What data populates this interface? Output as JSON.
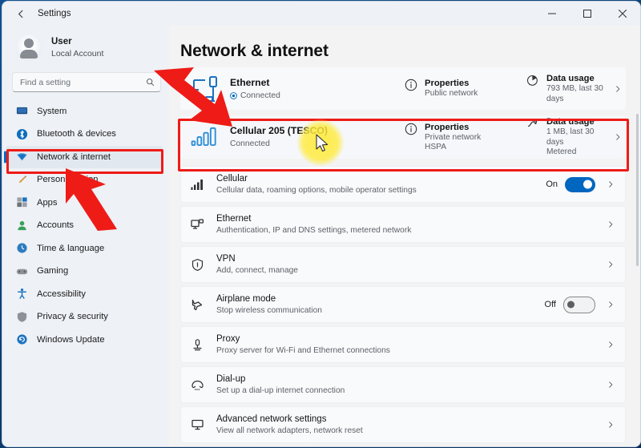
{
  "window": {
    "title": "Settings",
    "back_icon": "back-arrow-icon",
    "minimize_label": "Minimize",
    "maximize_label": "Maximize",
    "close_label": "Close"
  },
  "sidebar": {
    "account": {
      "name": "User",
      "subtitle": "Local Account",
      "avatar_icon": "avatar-icon"
    },
    "search": {
      "placeholder": "Find a setting",
      "value": "",
      "icon": "search-icon"
    },
    "items": [
      {
        "label": "System",
        "icon": "system-icon",
        "selected": false
      },
      {
        "label": "Bluetooth & devices",
        "icon": "bluetooth-icon",
        "selected": false
      },
      {
        "label": "Network & internet",
        "icon": "network-icon",
        "selected": true
      },
      {
        "label": "Personalization",
        "icon": "personalization-icon",
        "selected": false
      },
      {
        "label": "Apps",
        "icon": "apps-icon",
        "selected": false
      },
      {
        "label": "Accounts",
        "icon": "accounts-icon",
        "selected": false
      },
      {
        "label": "Time & language",
        "icon": "time-language-icon",
        "selected": false
      },
      {
        "label": "Gaming",
        "icon": "gaming-icon",
        "selected": false
      },
      {
        "label": "Accessibility",
        "icon": "accessibility-icon",
        "selected": false
      },
      {
        "label": "Privacy & security",
        "icon": "privacy-security-icon",
        "selected": false
      },
      {
        "label": "Windows Update",
        "icon": "windows-update-icon",
        "selected": false
      }
    ]
  },
  "main": {
    "page_title": "Network & internet",
    "status_cards": [
      {
        "id": "ethernet",
        "icon": "ethernet-status-icon",
        "title": "Ethernet",
        "status": "Connected",
        "properties": {
          "title": "Properties",
          "lines": [
            "Public network"
          ],
          "icon": "info-icon"
        },
        "data_usage": {
          "title": "Data usage",
          "lines": [
            "793 MB, last 30 days"
          ],
          "icon": "data-usage-icon"
        },
        "chevron": "chevron-right-icon",
        "highlighted": false
      },
      {
        "id": "cellular",
        "icon": "cellular-signal-icon",
        "title": "Cellular 205 (TESCO)",
        "status": "Connected",
        "properties": {
          "title": "Properties",
          "lines": [
            "Private network",
            "HSPA"
          ],
          "icon": "info-icon"
        },
        "data_usage": {
          "title": "Data usage",
          "lines": [
            "1 MB, last 30 days",
            "Metered"
          ],
          "icon": "data-usage-icon"
        },
        "chevron": "chevron-right-icon",
        "highlighted": true
      }
    ],
    "rows": [
      {
        "icon": "cellular-bars-icon",
        "title": "Cellular",
        "subtitle": "Cellular data, roaming options, mobile operator settings",
        "toggle": {
          "state": "On",
          "on": true
        },
        "chevron": "chevron-right-icon"
      },
      {
        "icon": "ethernet-icon",
        "title": "Ethernet",
        "subtitle": "Authentication, IP and DNS settings, metered network",
        "toggle": null,
        "chevron": "chevron-right-icon"
      },
      {
        "icon": "vpn-shield-icon",
        "title": "VPN",
        "subtitle": "Add, connect, manage",
        "toggle": null,
        "chevron": "chevron-right-icon"
      },
      {
        "icon": "airplane-icon",
        "title": "Airplane mode",
        "subtitle": "Stop wireless communication",
        "toggle": {
          "state": "Off",
          "on": false
        },
        "chevron": "chevron-right-icon"
      },
      {
        "icon": "proxy-icon",
        "title": "Proxy",
        "subtitle": "Proxy server for Wi-Fi and Ethernet connections",
        "toggle": null,
        "chevron": "chevron-right-icon"
      },
      {
        "icon": "dialup-icon",
        "title": "Dial-up",
        "subtitle": "Set up a dial-up internet connection",
        "toggle": null,
        "chevron": "chevron-right-icon"
      },
      {
        "icon": "advanced-network-icon",
        "title": "Advanced network settings",
        "subtitle": "View all network adapters, network reset",
        "toggle": null,
        "chevron": "chevron-right-icon"
      }
    ]
  },
  "annotations": {
    "accent_red": "#ee1b17",
    "highlight_yellow": "#ffeb3c",
    "accent_blue": "#0067c0",
    "arrows": [
      {
        "name": "arrow-to-cellular-card",
        "direction": "down-right"
      },
      {
        "name": "arrow-to-network-sidebar-item",
        "direction": "up-left"
      }
    ],
    "boxes": [
      {
        "name": "highlight-box-cellular-card"
      },
      {
        "name": "highlight-box-sidebar-network"
      }
    ],
    "cursor": {
      "name": "mouse-cursor",
      "glow": true
    }
  }
}
